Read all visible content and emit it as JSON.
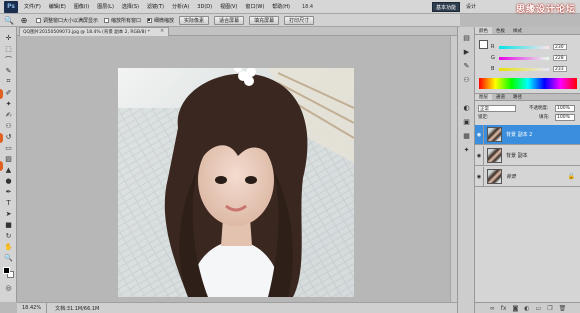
{
  "app": {
    "logo": "Ps"
  },
  "menu": [
    "文件(F)",
    "编辑(E)",
    "图像(I)",
    "图层(L)",
    "选择(S)",
    "滤镜(T)",
    "分析(A)",
    "3D(D)",
    "视图(V)",
    "窗口(W)",
    "帮助(H)"
  ],
  "zoom_display": "18.4",
  "workspace": {
    "active": "基本功能",
    "design": "设计",
    "painting": "绘画"
  },
  "watermark": "思缘设计论坛",
  "watermark_url": "www.MISSYUAN.COM",
  "options": {
    "resize_window": "调整窗口大小以满屏显示",
    "zoom_all": "缩放所有窗口",
    "scrubby": "细微缩放",
    "actual_pixels": "实际像素",
    "fit_screen": "适合屏幕",
    "fill_screen": "填充屏幕",
    "print_size": "打印尺寸"
  },
  "document": {
    "tab_title": "QQ图片20150509073.jpg @ 18.4% (背景 副本 2, RGB/8) *",
    "close": "×"
  },
  "status": {
    "zoom": "18.42%",
    "doc": "文档:31.1M/66.1M"
  },
  "color_panel": {
    "tabs": [
      "颜色",
      "色板",
      "样式"
    ],
    "r": {
      "label": "R",
      "value": "230",
      "color": "#e65a5a"
    },
    "g": {
      "label": "G",
      "value": "228",
      "color": "#5ac85a"
    },
    "b": {
      "label": "B",
      "value": "233",
      "color": "#5a5ae6"
    }
  },
  "layers_panel": {
    "tabs": [
      "图层",
      "通道",
      "路径"
    ],
    "blend_mode": "正常",
    "opacity_label": "不透明度:",
    "opacity": "100%",
    "lock_label": "锁定:",
    "fill_label": "填充:",
    "fill": "100%",
    "layers": [
      {
        "name": "背景 副本 2",
        "selected": true
      },
      {
        "name": "背景 副本",
        "selected": false
      },
      {
        "name": "背景",
        "selected": false,
        "locked": true
      }
    ]
  },
  "colors": {
    "selected_layer": "#3b8ede",
    "brand": "#1a2f4d"
  }
}
